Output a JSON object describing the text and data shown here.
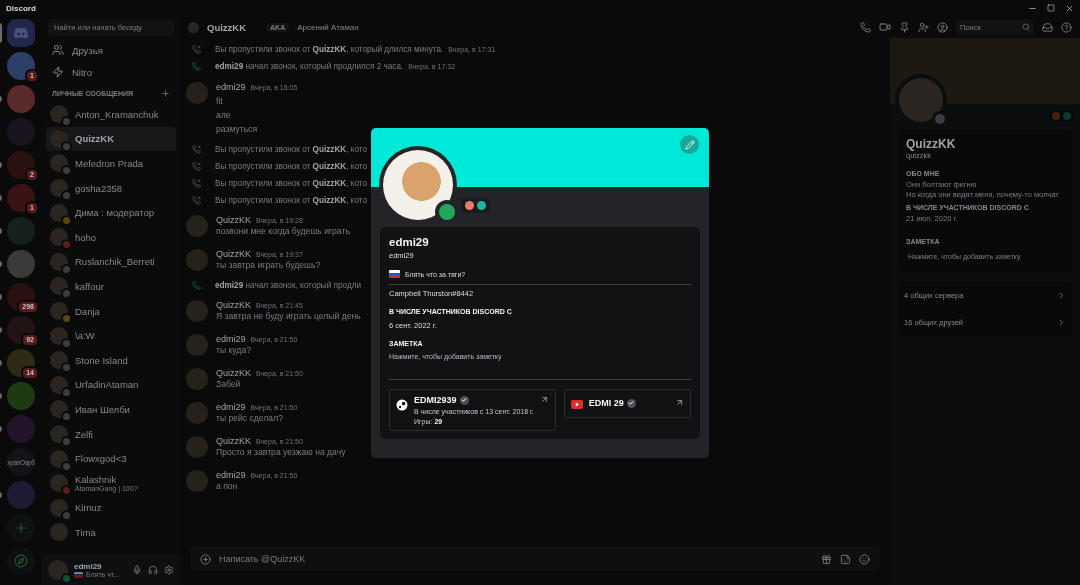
{
  "window": {
    "title": "Discord"
  },
  "servers": [
    {
      "kind": "home",
      "selected": true
    },
    {
      "kind": "server",
      "unread": false,
      "badge": "1",
      "color": "#2c3f66"
    },
    {
      "kind": "server",
      "unread": true,
      "color": "#5a2a2a"
    },
    {
      "kind": "server",
      "unread": false,
      "color": "#1a1420"
    },
    {
      "kind": "server",
      "unread": true,
      "badge": "2",
      "color": "#2a1212"
    },
    {
      "kind": "server",
      "unread": true,
      "badge": "1",
      "color": "#3a1414"
    },
    {
      "kind": "server",
      "unread": true,
      "color": "#16201c"
    },
    {
      "kind": "server",
      "unread": true,
      "color": "#3a3a3a"
    },
    {
      "kind": "server",
      "unread": true,
      "badge": "298",
      "color": "#2a1010"
    },
    {
      "kind": "server",
      "unread": true,
      "badge": "92",
      "color": "#221414"
    },
    {
      "kind": "server",
      "unread": true,
      "badge": "14",
      "color": "#2e2a14"
    },
    {
      "kind": "server",
      "unread": true,
      "color": "#1f3a12"
    },
    {
      "kind": "server",
      "unread": true,
      "color": "#24142a"
    },
    {
      "kind": "server",
      "unread": false,
      "label": "храпОарб",
      "color": "#121316"
    },
    {
      "kind": "server",
      "unread": true,
      "color": "#1e1a34"
    },
    {
      "kind": "add"
    },
    {
      "kind": "explore"
    }
  ],
  "dm_sidebar": {
    "search": {
      "placeholder": "Найти или начать беседу"
    },
    "nav": [
      {
        "kind": "friends",
        "label": "Друзья"
      },
      {
        "kind": "nitro",
        "label": "Nitro"
      }
    ],
    "section_title": "ЛИЧНЫЕ СООБЩЕНИЯ",
    "conversations": [
      {
        "name": "Anton_Kramanchuk",
        "color": "#3a3c40",
        "selected": false
      },
      {
        "name": "QuizzKK",
        "color": "#3a3c40",
        "selected": true
      },
      {
        "name": "Mefedron Prada",
        "color": "#3a3c40",
        "selected": false
      },
      {
        "name": "gosha2358",
        "color": "#3a3c40",
        "selected": false
      },
      {
        "name": "Дима : модератор",
        "color": "#5a4414",
        "selected": false
      },
      {
        "name": "hoho",
        "color": "#5a1c1e",
        "selected": false
      },
      {
        "name": "Ruslanchik_Berreti",
        "color": "#3a3c40",
        "selected": false
      },
      {
        "name": "kaffour",
        "color": "#3a3c40",
        "selected": false
      },
      {
        "name": "Danja",
        "color": "#5a4414",
        "selected": false
      },
      {
        "name": "\\a:W",
        "color": "#3a3c40",
        "selected": false
      },
      {
        "name": "Stone Island",
        "color": "#3a3c40",
        "selected": false
      },
      {
        "name": "UrfadinAtaman",
        "color": "#3a3c40",
        "selected": false
      },
      {
        "name": "Иван Шелби",
        "color": "#3a3c40",
        "selected": false
      },
      {
        "name": "Zelfi",
        "color": "#3a3c40",
        "selected": false
      },
      {
        "name": "Flowxgod<3",
        "color": "#3a3c40",
        "selected": false
      },
      {
        "name": "Kalashnik",
        "subtitle": "AtamanGang | 100?",
        "color": "#5a1c1e",
        "selected": false
      },
      {
        "name": "Kimuz",
        "color": "#3a3c40",
        "selected": false
      },
      {
        "name": "Tima",
        "selected": false
      }
    ],
    "user_panel": {
      "name": "edmi29",
      "status_text": "Блять чт...",
      "color": "#14502c"
    }
  },
  "chat_header": {
    "name": "QuizzKK",
    "aka_label": "AKA",
    "aka_name": "Арсений Атаман",
    "search": {
      "placeholder": "Поиск"
    }
  },
  "messages": [
    {
      "kind": "missed_call",
      "text": "Вы пропустили звонок от **QuizzKK**, который длился минута.",
      "time": "Вчера, в 17:31"
    },
    {
      "kind": "call",
      "text": "**edmi29** начал звонок, который продлился 2 часа.",
      "time": "Вчера, в 17:32"
    },
    {
      "kind": "message",
      "author": "edmi29",
      "time": "Вчера, в 18:05",
      "lines": [
        "fit",
        "але",
        "размуться"
      ]
    },
    {
      "kind": "missed_call",
      "text": "Вы пропустили звонок от **QuizzKK**, кото"
    },
    {
      "kind": "missed_call",
      "text": "Вы пропустили звонок от **QuizzKK**, кото"
    },
    {
      "kind": "missed_call",
      "text": "Вы пропустили звонок от **QuizzKK**, кото"
    },
    {
      "kind": "missed_call",
      "text": "Вы пропустили звонок от **QuizzKK**, кото"
    },
    {
      "kind": "message",
      "author": "QuizzKK",
      "time": "Вчера, в 19:28",
      "lines": [
        "позвони мне когда будешь играть"
      ]
    },
    {
      "kind": "message",
      "author": "QuizzKK",
      "time": "Вчера, в 19:37",
      "lines": [
        "ты завтра играть будешь?"
      ]
    },
    {
      "kind": "call",
      "text": "**edmi29** начал звонок, который продли"
    },
    {
      "kind": "message",
      "author": "QuizzKK",
      "time": "Вчера, в 21:45",
      "lines": [
        "Я завтра не буду играть целый день"
      ]
    },
    {
      "kind": "message",
      "author": "edmi29",
      "time": "Вчера, в 21:50",
      "lines": [
        "ты куда?"
      ]
    },
    {
      "kind": "message",
      "author": "QuizzKK",
      "time": "Вчера, в 21:50",
      "lines": [
        "Забей"
      ]
    },
    {
      "kind": "message",
      "author": "edmi29",
      "time": "Вчера, в 21:50",
      "lines": [
        "ты рейс сделал?"
      ]
    },
    {
      "kind": "message",
      "author": "QuizzKK",
      "time": "Вчера, в 21:50",
      "lines": [
        "Просто я завтра уезжаю на дачу"
      ]
    },
    {
      "kind": "message",
      "author": "edmi29",
      "time": "Вчера, в 21:50",
      "lines": [
        "а пон"
      ]
    }
  ],
  "composer": {
    "placeholder": "Написать @QuizzKK"
  },
  "side_profile": {
    "name": "QuizzKK",
    "username": "quizzkk",
    "color": "#3a3c40",
    "sections": [
      {
        "title": "ОБО МНЕ",
        "lines": [
          "Они болтают фигню",
          "Но когда они видят меня, почему-то молчат"
        ]
      },
      {
        "title": "В ЧИСЛЕ УЧАСТНИКОВ DISCORD С",
        "lines": [
          "21 июл. 2020 г."
        ]
      }
    ],
    "note": {
      "title": "ЗАМЕТКА",
      "placeholder": "Нажмите, чтобы добавить заметку"
    },
    "mutuals": [
      "4 общих сервера",
      "16 общих друзей"
    ]
  },
  "profile_modal": {
    "color": "#23a55a",
    "display_name": "edmi29",
    "username": "edmi29",
    "custom_status": "Блять что за тяги?",
    "about": "Campbell Thurston#8442",
    "member_since": {
      "title": "В ЧИСЛЕ УЧАСТНИКОВ DISCORD С",
      "value": "6 сент. 2022 г."
    },
    "note": {
      "title": "ЗАМЕТКА",
      "placeholder": "Нажмите, чтобы добавить заметку"
    },
    "connections": [
      {
        "kind": "steam",
        "name": "EDMI2939",
        "verified": true,
        "details": [
          "В числе участников с 13 сент. 2018 г.",
          "Игры: **29**"
        ]
      },
      {
        "kind": "youtube",
        "name": "EDMI 29",
        "verified": true
      }
    ]
  }
}
